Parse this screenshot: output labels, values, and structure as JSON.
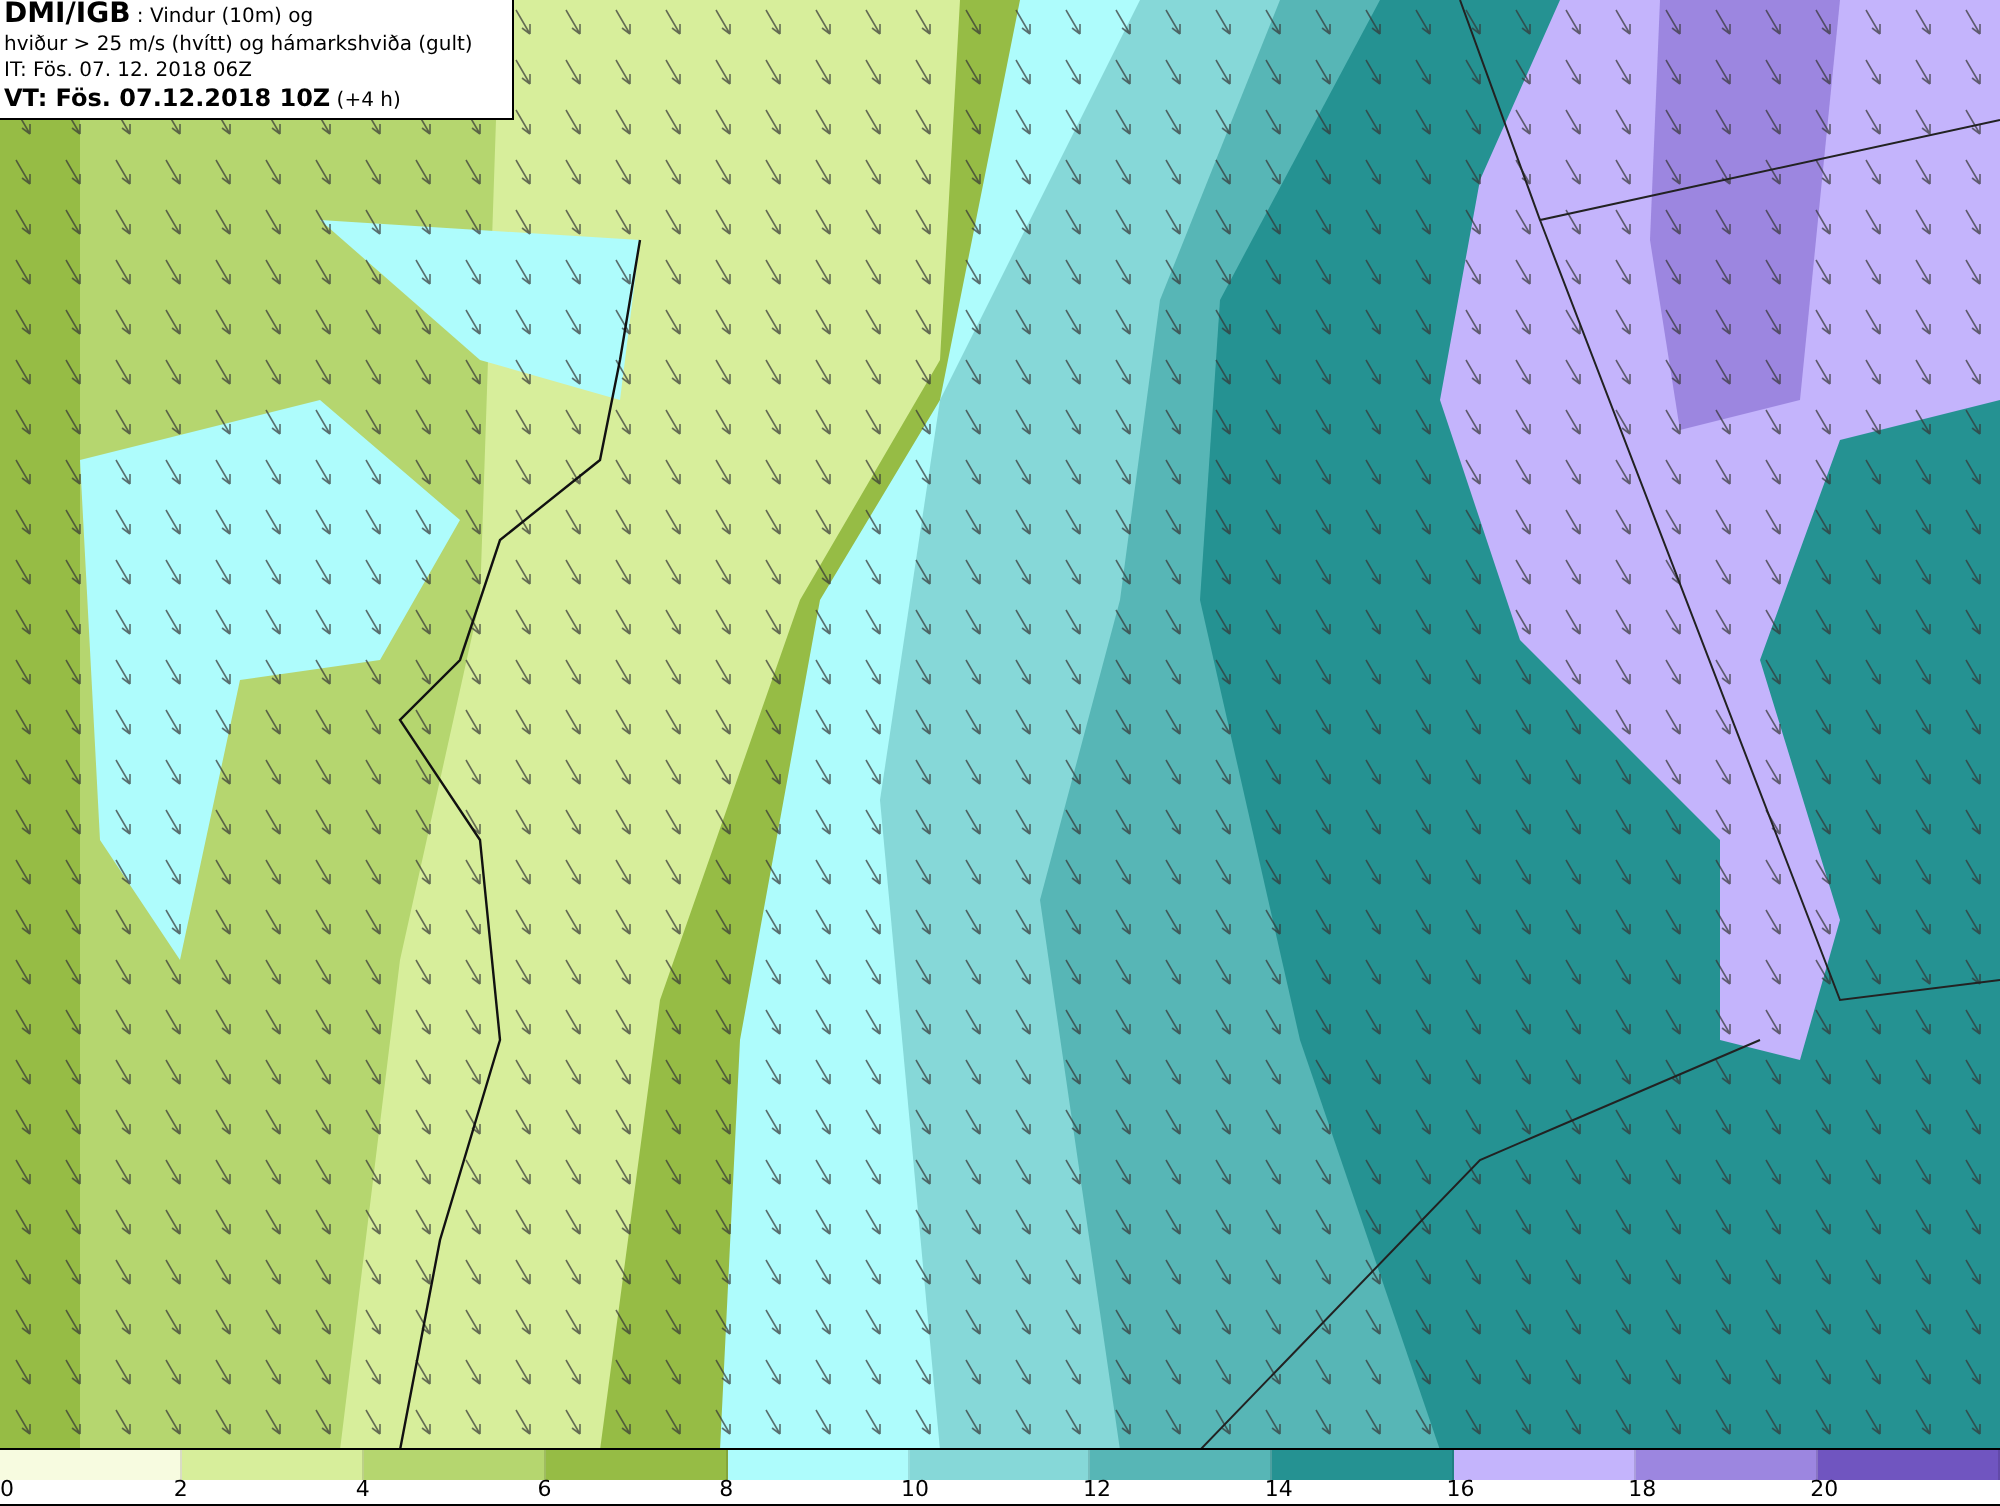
{
  "header": {
    "lines": [
      "**DMI/IGB** : Vindur (10m) og",
      "hviður > 25 m/s (hvítt) og hámarkshviða (gult)",
      "IT: Fös. 07. 12. 2018 06Z",
      "**VT: Fös. 07.12.2018 10Z** (+4 h)"
    ]
  },
  "legend": {
    "bins": [
      {
        "color": "#f7fbe0"
      },
      {
        "color": "#d7ee9b"
      },
      {
        "color": "#b5d66f"
      },
      {
        "color": "#96bc45"
      },
      {
        "color": "#aefcfc"
      },
      {
        "color": "#86d8d8"
      },
      {
        "color": "#57b6b6"
      },
      {
        "color": "#259292"
      },
      {
        "color": "#c4b4fc"
      },
      {
        "color": "#9c86e0"
      },
      {
        "color": "#7055c0"
      }
    ],
    "labels": [
      "0",
      "2",
      "4",
      "6",
      "8",
      "10",
      "12",
      "14",
      "16",
      "18",
      "20"
    ]
  }
}
